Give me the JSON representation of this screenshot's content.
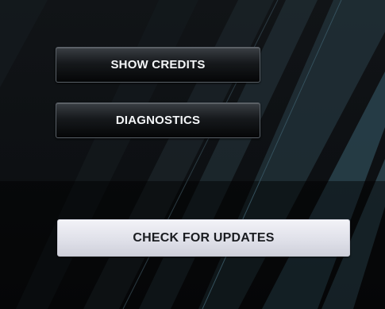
{
  "panel": {
    "show_credits_label": "SHOW CREDITS",
    "diagnostics_label": "DIAGNOSTICS",
    "check_updates_label": "CHECK FOR UPDATES"
  },
  "colors": {
    "background": "#0b0d0f",
    "accent_teal": "#2e4a55",
    "light_button": "#dedfe8",
    "dark_button": "#16191c"
  }
}
